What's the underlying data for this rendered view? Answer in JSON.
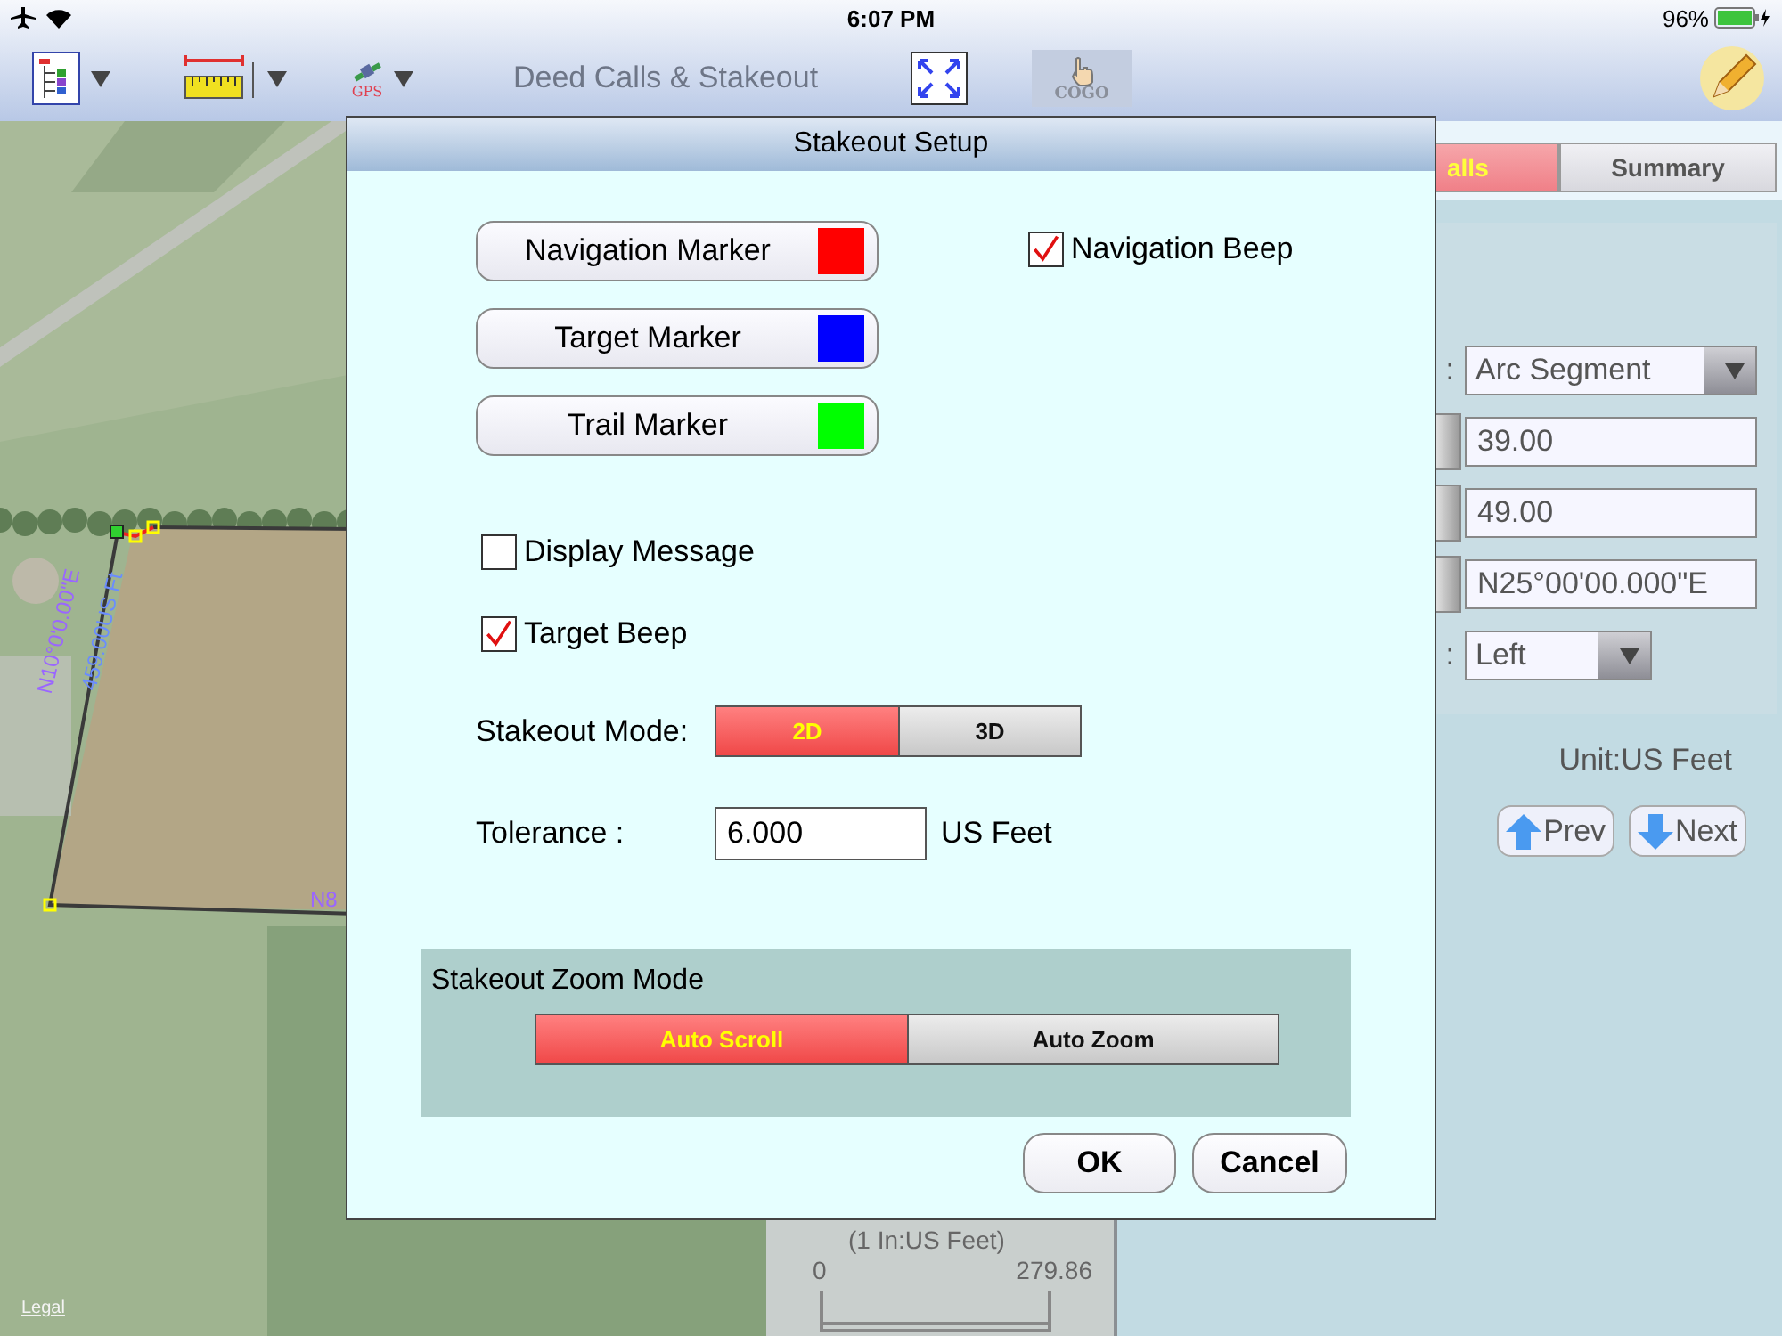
{
  "status_bar": {
    "time": "6:07 PM",
    "battery": "96%"
  },
  "toolbar": {
    "gps_label": "GPS",
    "title": "Deed Calls & Stakeout",
    "cogo_label": "COGO",
    "cogo_disabled": true
  },
  "map": {
    "kind": "picture",
    "labels": [
      {
        "text": "N10°0'0.00\"E",
        "kind": "bearing"
      },
      {
        "text": "459.00US Ft",
        "kind": "distance"
      },
      {
        "text": "N8",
        "kind": "bearing"
      }
    ],
    "legal_link": "Legal",
    "scale": {
      "caption": "(1 In:US Feet)",
      "start": "0",
      "end": "279.86"
    }
  },
  "side_panel": {
    "tabs": [
      {
        "label": "alls",
        "selected": true
      },
      {
        "label": "Summary",
        "selected": false
      }
    ],
    "type_label": ":",
    "type_value": "Arc Segment",
    "fields": [
      "39.00",
      "49.00",
      "N25°00'00.000\"E"
    ],
    "direction_label": ":",
    "direction_value": "Left",
    "unit": "Unit:US Feet",
    "buttons": [
      {
        "label": "Prev",
        "kind": "up"
      },
      {
        "label": "Next",
        "kind": "down"
      }
    ]
  },
  "dialog": {
    "title": "Stakeout Setup",
    "markers": [
      {
        "label": "Navigation Marker",
        "color": "#ff0000"
      },
      {
        "label": "Target Marker",
        "color": "#0000ff"
      },
      {
        "label": "Trail Marker",
        "color": "#00ff00"
      }
    ],
    "options": [
      {
        "label": "Navigation Beep",
        "checked": true
      },
      {
        "label": "Display Message",
        "checked": false
      },
      {
        "label": "Target Beep",
        "checked": true
      }
    ],
    "mode": {
      "label": "Stakeout Mode:",
      "options": [
        {
          "label": "2D",
          "selected": true
        },
        {
          "label": "3D",
          "selected": false
        }
      ]
    },
    "tolerance": {
      "label": "Tolerance :",
      "value": "6.000",
      "unit": "US Feet"
    },
    "zoom_mode": {
      "title": "Stakeout Zoom Mode",
      "options": [
        {
          "label": "Auto Scroll",
          "selected": true
        },
        {
          "label": "Auto Zoom",
          "selected": false
        }
      ]
    },
    "buttons": [
      {
        "label": "OK"
      },
      {
        "label": "Cancel"
      }
    ]
  }
}
